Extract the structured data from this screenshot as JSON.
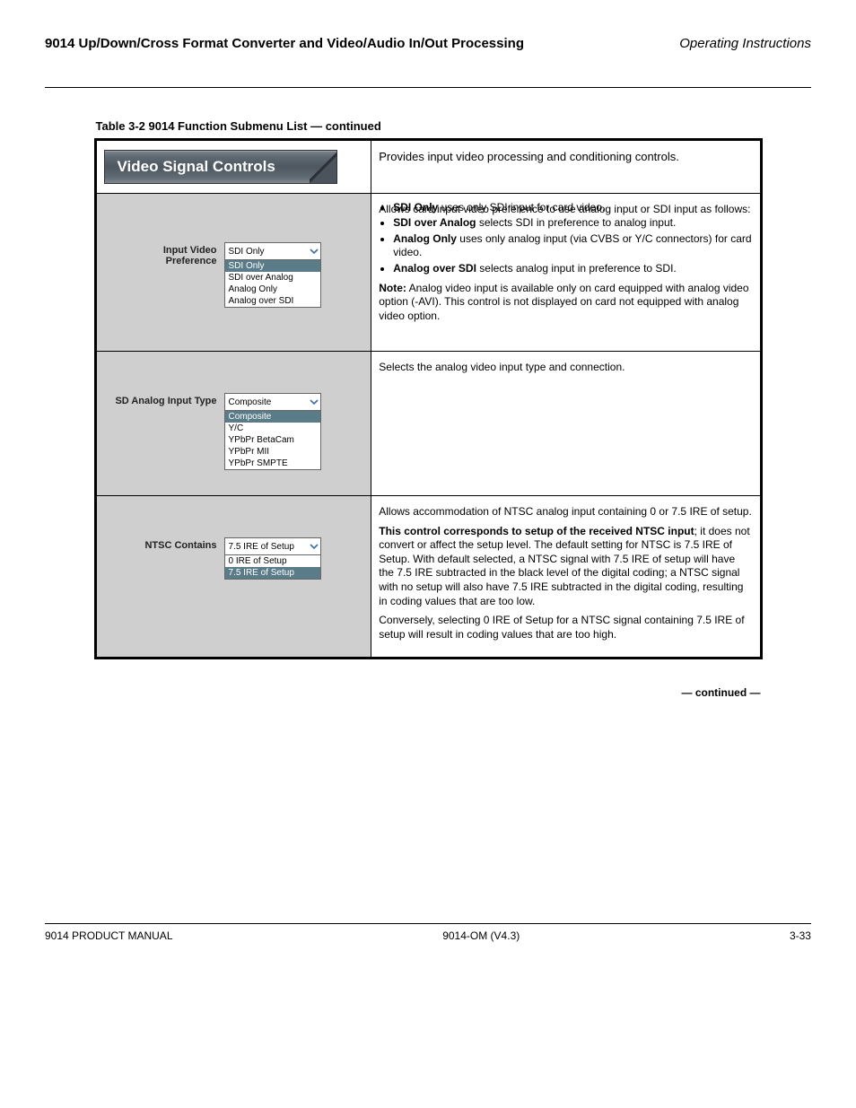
{
  "header": {
    "left": "9014 Up/Down/Cross Format Converter and Video/Audio In/Out Processing",
    "right": "Operating Instructions"
  },
  "table_caption": "Table 3-2     9014 Function Submenu List — continued",
  "banner_title": "Video Signal Controls",
  "banner_desc": "Provides input video processing and conditioning controls.",
  "row1": {
    "label": "Input Video Preference",
    "selected": "SDI Only",
    "opts": [
      "SDI Only",
      "SDI over Analog",
      "Analog Only",
      "Analog over SDI"
    ],
    "desc_intro": "Allows card input video preference to use analog input or SDI input as follows:",
    "items": [
      "SDI Only uses only SDI input for card video.",
      "SDI over Analog selects SDI in preference to analog input.",
      "Analog Only uses only analog input (via CVBS or Y/C connectors) for card video.",
      "Analog over SDI selects analog input in preference to SDI."
    ],
    "note_label": "Note:",
    "note": "Analog video input is available only on card equipped with analog video option (-AVI). This control is not displayed on card not equipped with analog video option."
  },
  "row2": {
    "label": "SD Analog Input Type",
    "selected": "Composite",
    "opts": [
      "Composite",
      "Y/C",
      "YPbPr BetaCam",
      "YPbPr MII",
      "YPbPr SMPTE"
    ],
    "desc": "Selects the analog video input type and connection."
  },
  "row3": {
    "label": "NTSC Contains",
    "selected": "7.5 IRE of Setup",
    "opts": [
      "0 IRE of Setup",
      "7.5 IRE of Setup"
    ],
    "desc_intro": "Allows accommodation of NTSC analog input containing 0 or 7.5 IRE of setup.",
    "note_bold": "This control corresponds to setup of the received NTSC input",
    "note_rest": "; it does not convert or affect the setup level. The default setting for NTSC is 7.5 IRE of Setup. With default selected, a NTSC signal with 7.5 IRE of setup will have the 7.5 IRE subtracted in the black level of the digital coding; a NTSC signal with no setup will also have 7.5 IRE subtracted in the digital coding, resulting in coding values that are too low.",
    "note2": "Conversely, selecting 0 IRE of Setup for a NTSC signal containing 7.5 IRE of setup will result in coding values that are too high."
  },
  "continued": "— continued —",
  "footer": {
    "left": "9014 PRODUCT MANUAL",
    "center": "9014-OM (V4.3)",
    "right": "3-33"
  }
}
